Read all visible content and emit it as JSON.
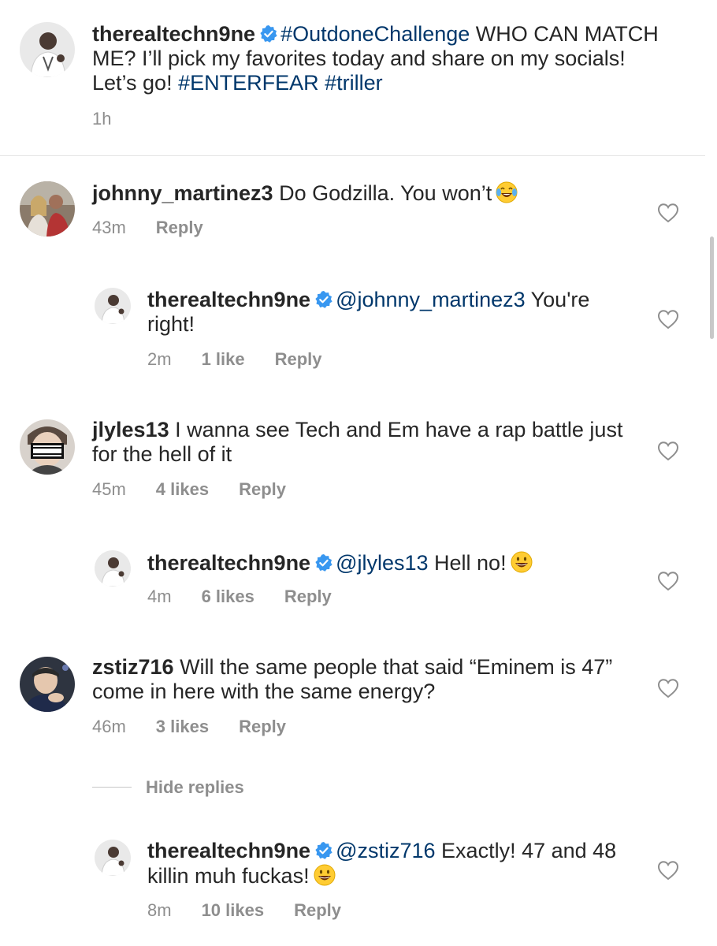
{
  "post": {
    "username": "therealtechn9ne",
    "caption_hashtag1": "#OutdoneChallenge",
    "caption_text": " WHO CAN MATCH ME? I’ll pick my favorites today and share on my socials! Let’s go! ",
    "caption_hashtag2": "#ENTERFEAR",
    "caption_hashtag3": "#triller",
    "time": "1h"
  },
  "comments": [
    {
      "username": "johnny_martinez3",
      "text": " Do Godzilla. You won’t",
      "emoji": "tears-of-joy-emoji",
      "time": "43m",
      "reply_label": "Reply"
    },
    {
      "username": "therealtechn9ne",
      "mention": "@johnny_martinez3",
      "text": " You're right!",
      "time": "2m",
      "likes": "1 like",
      "reply_label": "Reply"
    },
    {
      "username": "jlyles13",
      "text": " I wanna see Tech and Em have a rap battle just for the hell of it",
      "time": "45m",
      "likes": "4 likes",
      "reply_label": "Reply"
    },
    {
      "username": "therealtechn9ne",
      "mention": "@jlyles13",
      "text": "  Hell no!",
      "emoji": "grinning-emoji",
      "time": "4m",
      "likes": "6 likes",
      "reply_label": "Reply"
    },
    {
      "username": "zstiz716",
      "text": " Will the same people that said “Eminem is 47” come in here with the same energy?",
      "time": "46m",
      "likes": "3 likes",
      "reply_label": "Reply"
    },
    {
      "username": "therealtechn9ne",
      "mention": "@zstiz716",
      "text": " Exactly! 47 and 48 killin muh fuckas!",
      "emoji": "grinning-emoji",
      "time": "8m",
      "likes": "10 likes",
      "reply_label": "Reply"
    }
  ],
  "hide_replies_label": "Hide replies",
  "colors": {
    "text": "#262626",
    "link": "#00376b",
    "meta": "#8e8e8e",
    "verified": "#3897f0"
  }
}
